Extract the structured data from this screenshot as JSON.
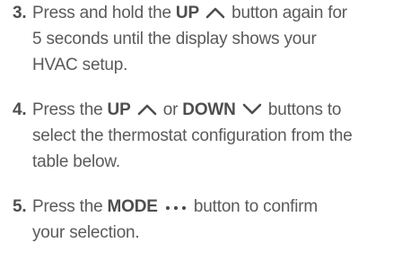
{
  "steps": [
    {
      "number": "3.",
      "pre": "Press and hold the ",
      "key": "UP",
      "post_line1": " button again for",
      "line2": "5 seconds until the display shows your",
      "line3": "HVAC setup."
    },
    {
      "number": "4.",
      "pre": "Press the ",
      "key1": "UP",
      "mid": " or ",
      "key2": "DOWN",
      "post_line1": " buttons to",
      "line2": "select the thermostat configuration from the",
      "line3": "table below."
    },
    {
      "number": "5.",
      "pre": "Press the ",
      "key": "MODE",
      "post_line1": " button to confirm",
      "line2": "your selection."
    }
  ],
  "icons": {
    "up": "chevron-up-icon",
    "down": "chevron-down-icon",
    "mode": "ellipsis-icon"
  },
  "colors": {
    "text": "#5a5a5a",
    "bold": "#4e4e4e"
  }
}
